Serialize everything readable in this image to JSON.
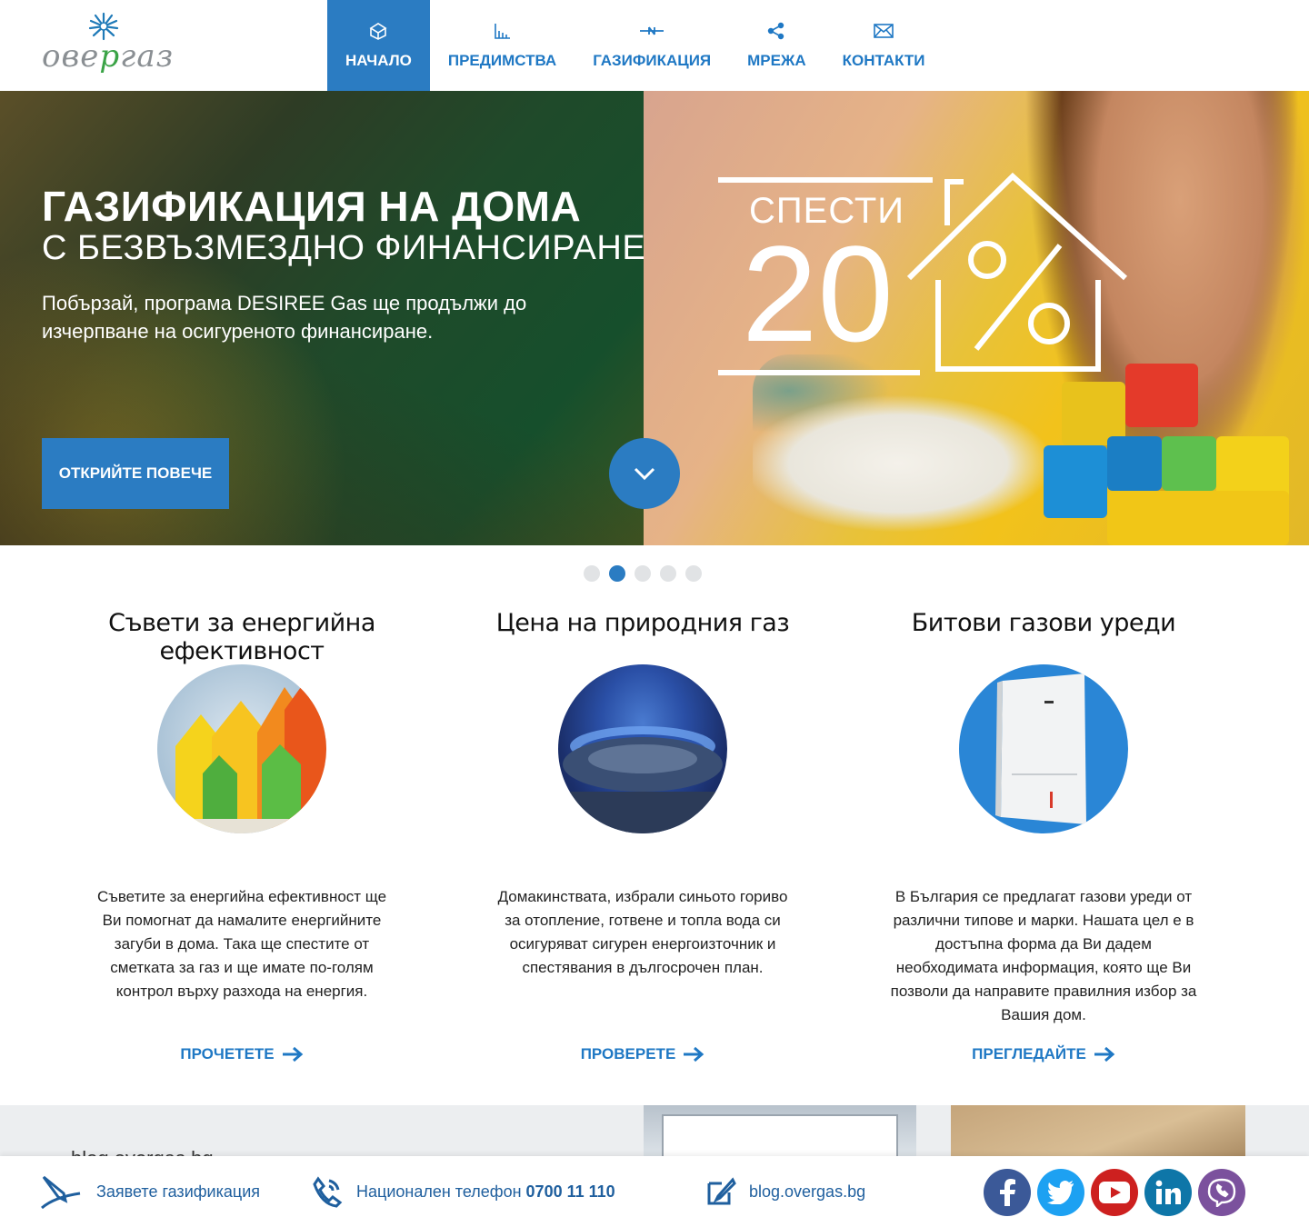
{
  "header": {
    "logo_text_a": "ове",
    "logo_text_b": "р",
    "logo_text_c": "газ",
    "nav": [
      {
        "label": "НАЧАЛО",
        "icon": "home-box-icon",
        "active": true
      },
      {
        "label": "ПРЕДИМСТВА",
        "icon": "chart-icon",
        "active": false
      },
      {
        "label": "ГАЗИФИКАЦИЯ",
        "icon": "pipe-icon",
        "active": false
      },
      {
        "label": "МРЕЖА",
        "icon": "network-icon",
        "active": false
      },
      {
        "label": "КОНТАКТИ",
        "icon": "envelope-icon",
        "active": false
      }
    ]
  },
  "hero": {
    "title": "ГАЗИФИКАЦИЯ НА ДОМА",
    "subtitle": "С БЕЗВЪЗМЕЗДНО ФИНАНСИРАНЕ",
    "text": "Побързай, програма DESIREE Gas ще продължи до изчерпване на осигуреното финансиране.",
    "button": "ОТКРИЙТЕ ПОВЕЧЕ",
    "promo_word": "СПЕСТИ",
    "promo_number": "20",
    "promo_percent": "%"
  },
  "slider": {
    "count": 5,
    "active_index": 1
  },
  "features": [
    {
      "title": "Съвети за енергийна ефективност",
      "text": "Съветите за енергийна ефективност ще Ви помогнат да намалите енергийните загуби в дома. Така ще спестите от сметката за газ и ще имате по-голям контрол върху разхода на енергия.",
      "link": "ПРОЧЕТЕТЕ"
    },
    {
      "title": "Цена на природния газ",
      "text": "Домакинствата, избрали синьото гориво за отопление, готвене и топла вода си осигуряват сигурен енергоизточник и спестявания в дългосрочен план.",
      "link": "ПРОВЕРЕТЕ"
    },
    {
      "title": "Битови газови уреди",
      "text": "В България се предлагат газови уреди от различни типове и марки. Нашата цел е в достъпна форма да Ви дадем необходимата информация, която ще Ви позволи да направите правилния избор за Вашия дом.",
      "link": "ПРЕГЛЕДАЙТЕ"
    }
  ],
  "blog_strip": {
    "label": "blog.overgas.bg"
  },
  "footer": {
    "request": "Заявете газификация",
    "phone_label": "Национален телефон",
    "phone_number": "0700 11 110",
    "blog": "blog.overgas.bg",
    "social": [
      {
        "name": "facebook-icon",
        "color": "#3b5998",
        "glyph": "f"
      },
      {
        "name": "twitter-icon",
        "color": "#1da1f2",
        "glyph": ""
      },
      {
        "name": "youtube-icon",
        "color": "#cd201f",
        "glyph": ""
      },
      {
        "name": "linkedin-icon",
        "color": "#0e76a8",
        "glyph": "in"
      },
      {
        "name": "viber-icon",
        "color": "#7b519d",
        "glyph": ""
      }
    ]
  },
  "colors": {
    "accent": "#2b7cc2",
    "link": "#1f78c4",
    "dot_inactive": "#e1e3e5"
  }
}
